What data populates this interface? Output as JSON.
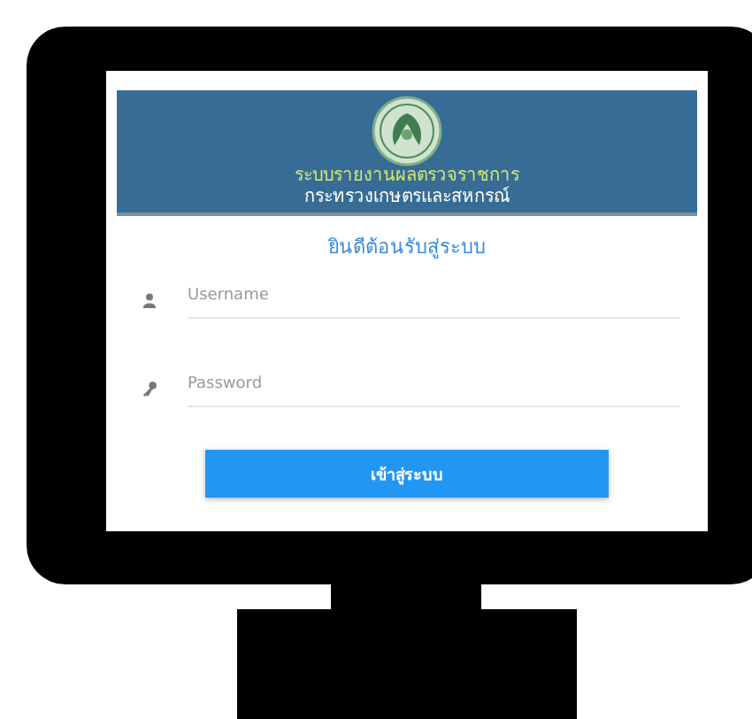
{
  "header": {
    "title": "ระบบรายงานผลตรวจราชการ",
    "subtitle": "กระทรวงเกษตรและสหกรณ์"
  },
  "welcome": "ยินดีต้อนรับสู่ระบบ",
  "fields": [
    {
      "kind": "user",
      "placeholder": "Username"
    },
    {
      "kind": "password",
      "placeholder": "Password"
    }
  ],
  "login_button": "เข้าสู่ระบบ"
}
